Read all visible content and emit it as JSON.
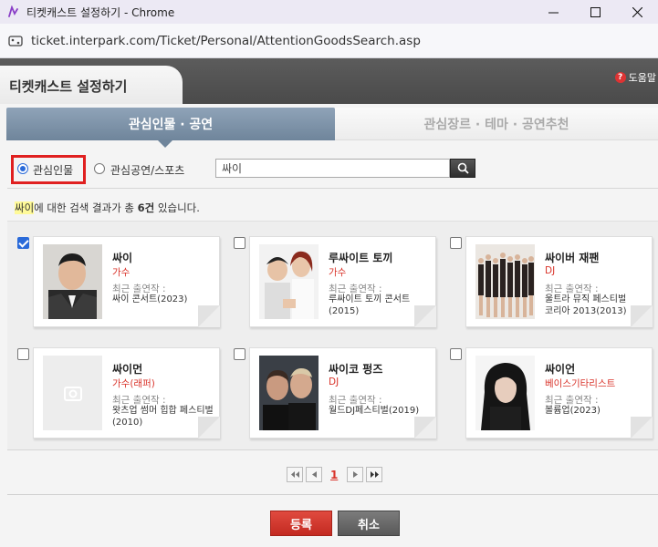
{
  "window": {
    "title": "티켓캐스트 설정하기 - Chrome",
    "url": "ticket.interpark.com/Ticket/Personal/AttentionGoodsSearch.asp"
  },
  "header": {
    "page_title": "티켓캐스트 설정하기",
    "help_label": "도움말"
  },
  "tabs": {
    "active": "관심인물 · 공연",
    "inactive": "관심장르 · 테마 · 공연추천"
  },
  "search": {
    "radio_person": "관심인물",
    "radio_show": "관심공연/스포츠",
    "selected": "관심인물",
    "query": "싸이"
  },
  "result": {
    "keyword": "싸이",
    "middle": "에 대한 검색 결과가 총 ",
    "count": "6건",
    "suffix": " 있습니다."
  },
  "cards": [
    {
      "name": "싸이",
      "role": "가수",
      "recent_label": "최근 출연작 :",
      "show": "싸이 콘서트(2023)",
      "checked": true
    },
    {
      "name": "루싸이트 토끼",
      "role": "가수",
      "recent_label": "최근 출연작 :",
      "show": "루싸이트 토끼 콘서트(2015)",
      "checked": false
    },
    {
      "name": "싸이버 재팬",
      "role": "DJ",
      "recent_label": "최근 출연작 :",
      "show": "울트라 뮤직 페스티벌 코리아 2013(2013)",
      "checked": false
    },
    {
      "name": "싸이먼",
      "role": "가수(래퍼)",
      "recent_label": "최근 출연작 :",
      "show": "왓츠업 썸머 힙합 페스티벌(2010)",
      "checked": false
    },
    {
      "name": "싸이코 펑즈",
      "role": "DJ",
      "recent_label": "최근 출연작 :",
      "show": "월드DJ페스티벌(2019)",
      "checked": false
    },
    {
      "name": "싸이언",
      "role": "베이스기타리스트",
      "recent_label": "최근 출연작 :",
      "show": "볼륨업(2023)",
      "checked": false
    }
  ],
  "pagination": {
    "current": "1"
  },
  "buttons": {
    "register": "등록",
    "cancel": "취소"
  },
  "colors": {
    "accent_red": "#d9342b",
    "tab_blue": "#7f94aa",
    "highlight_box": "#e02020"
  }
}
